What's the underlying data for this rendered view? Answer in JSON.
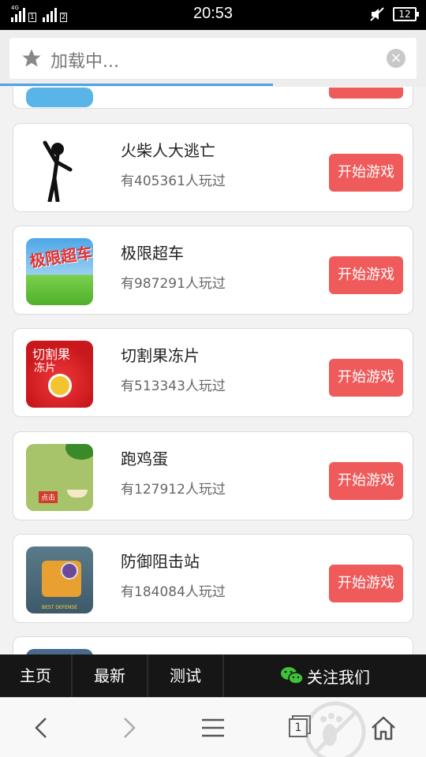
{
  "status_bar": {
    "sim1_label": "1",
    "sim2_label": "2",
    "net_label": "4G",
    "time": "20:53",
    "battery": "12"
  },
  "address_bar": {
    "loading_text": "加载中...",
    "clear_icon": "×"
  },
  "games": [
    {
      "name": "火柴人大逃亡",
      "plays": "有405361人玩过",
      "button": "开始游戏"
    },
    {
      "name": "极限超车",
      "plays": "有987291人玩过",
      "button": "开始游戏"
    },
    {
      "name": "切割果冻片",
      "plays": "有513343人玩过",
      "button": "开始游戏"
    },
    {
      "name": "跑鸡蛋",
      "plays": "有127912人玩过",
      "button": "开始游戏"
    },
    {
      "name": "防御阻击站",
      "plays": "有184084人玩过",
      "button": "开始游戏"
    }
  ],
  "thumb_text": {
    "racing": "极限超车",
    "jelly_top": "切割果",
    "jelly_bottom": "冻片",
    "egg_tag": "点击",
    "defense_tag": "BEST DEFENSE"
  },
  "bottom_nav": {
    "home": "主页",
    "latest": "最新",
    "test": "测试",
    "follow": "关注我们"
  },
  "toolbar": {
    "tab_count": "1"
  },
  "colors": {
    "accent": "#ef5a5a",
    "progress": "#4ba3e6",
    "nav_bg": "#161616"
  }
}
